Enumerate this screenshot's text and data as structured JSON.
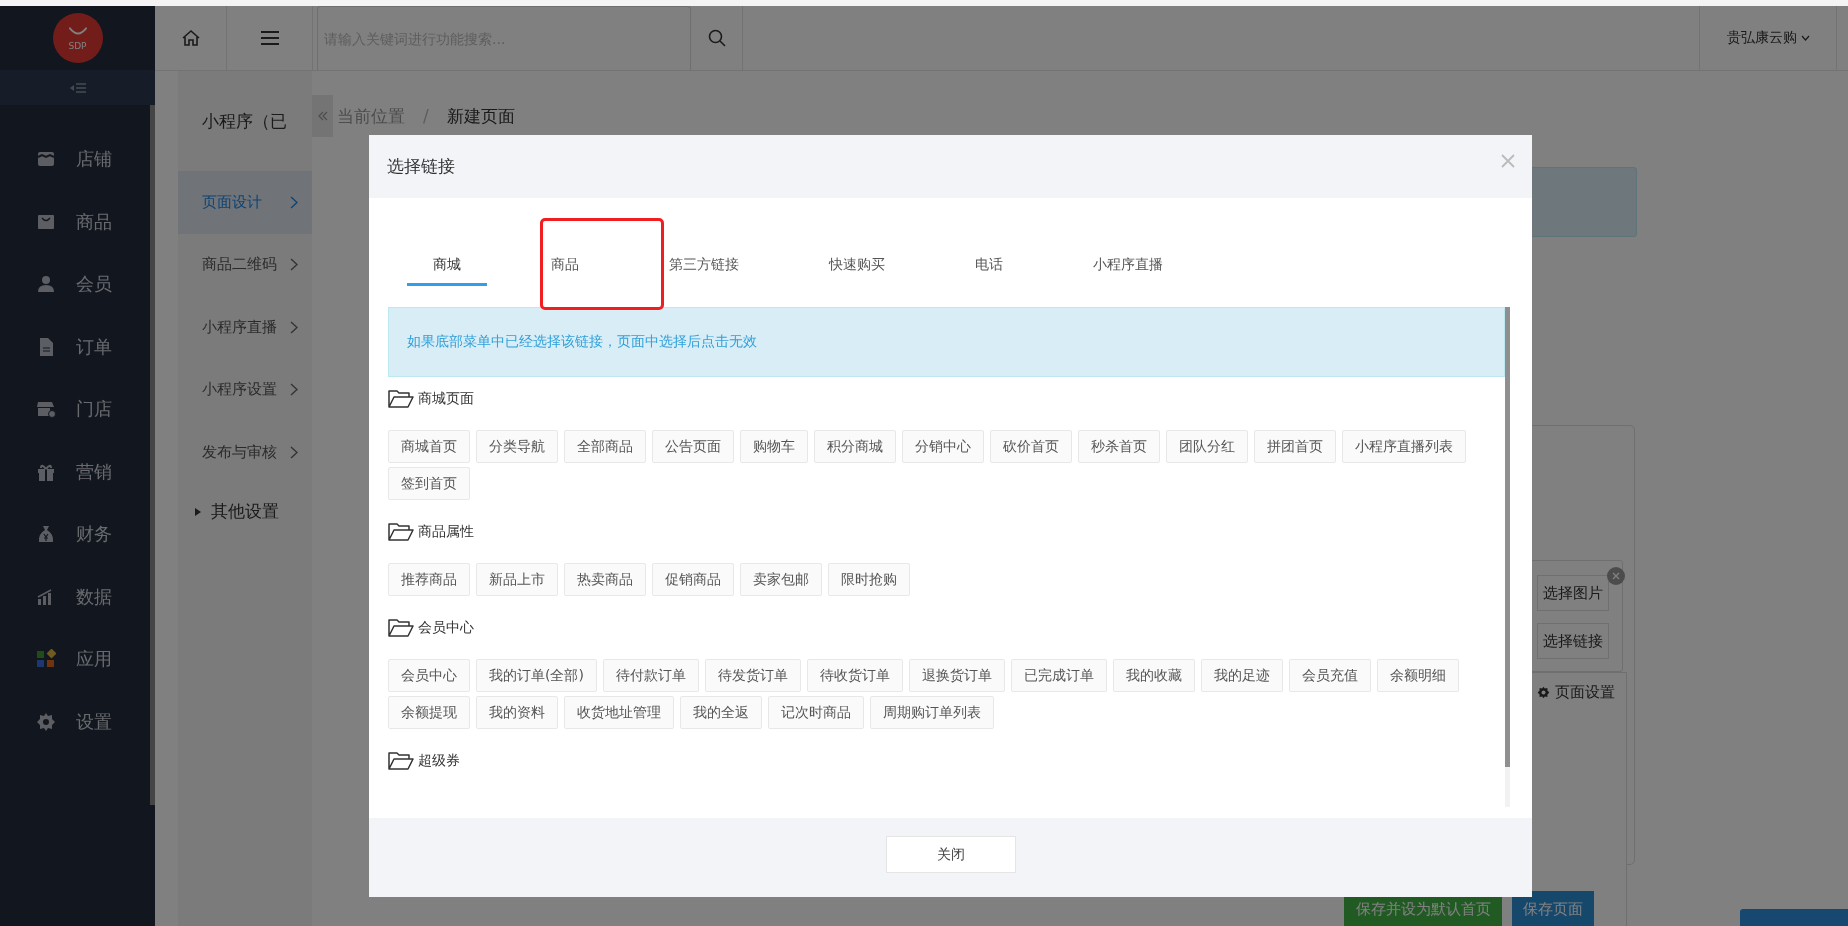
{
  "sidebar": {
    "logo": "SDP",
    "items": [
      {
        "label": "店铺",
        "kind": "store"
      },
      {
        "label": "商品",
        "kind": "bag"
      },
      {
        "label": "会员",
        "kind": "user"
      },
      {
        "label": "订单",
        "kind": "file"
      },
      {
        "label": "门店",
        "kind": "shop"
      },
      {
        "label": "营销",
        "kind": "gift"
      },
      {
        "label": "财务",
        "kind": "money"
      },
      {
        "label": "数据",
        "kind": "chart"
      },
      {
        "label": "应用",
        "kind": "apps"
      },
      {
        "label": "设置",
        "kind": "gear"
      }
    ]
  },
  "header": {
    "search": {
      "placeholder": "请输入关键词进行功能搜索..."
    },
    "user": "贵弘康云购"
  },
  "subnav": {
    "title": "小程序（已",
    "items": [
      {
        "label": "页面设计",
        "selected": true
      },
      {
        "label": "商品二维码",
        "selected": false
      },
      {
        "label": "小程序直播",
        "selected": false
      },
      {
        "label": "小程序设置",
        "selected": false
      },
      {
        "label": "发布与审核",
        "selected": false
      }
    ],
    "group": {
      "label": "其他设置",
      "expanded": false
    }
  },
  "breadcrumb": {
    "items": [
      "当前位置",
      "新建页面"
    ],
    "separator": "/"
  },
  "editor": {
    "image_button": "选择图片",
    "link_button": "选择链接",
    "page_settings": "页面设置",
    "save_default": "保存并设为默认首页",
    "save": "保存页面"
  },
  "dialog": {
    "title": "选择链接",
    "tabs": [
      {
        "label": "商城",
        "selected": true
      },
      {
        "label": "商品",
        "selected": false
      },
      {
        "label": "第三方链接",
        "selected": false
      },
      {
        "label": "快速购买",
        "selected": false
      },
      {
        "label": "电话",
        "selected": false
      },
      {
        "label": "小程序直播",
        "selected": false
      }
    ],
    "notice": "如果底部菜单中已经选择该链接，页面中选择后点击无效",
    "sections": [
      {
        "title": "商城页面",
        "links": [
          "商城首页",
          "分类导航",
          "全部商品",
          "公告页面",
          "购物车",
          "积分商城",
          "分销中心",
          "砍价首页",
          "秒杀首页",
          "团队分红",
          "拼团首页",
          "小程序直播列表",
          "签到首页"
        ]
      },
      {
        "title": "商品属性",
        "links": [
          "推荐商品",
          "新品上市",
          "热卖商品",
          "促销商品",
          "卖家包邮",
          "限时抢购"
        ]
      },
      {
        "title": "会员中心",
        "links": [
          "会员中心",
          "我的订单(全部)",
          "待付款订单",
          "待发货订单",
          "待收货订单",
          "退换货订单",
          "已完成订单",
          "我的收藏",
          "我的足迹",
          "会员充值",
          "余额明细",
          "余额提现",
          "我的资料",
          "收货地址管理",
          "我的全返",
          "记次时商品",
          "周期购订单列表"
        ]
      },
      {
        "title": "超级券"
      }
    ],
    "close_button": "关闭"
  }
}
